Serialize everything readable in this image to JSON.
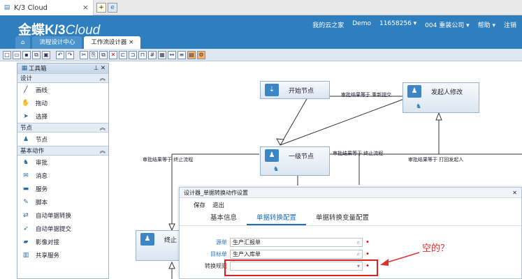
{
  "browser": {
    "tab_title": "K/3 Cloud",
    "close": "×"
  },
  "header": {
    "logo_main": "金蝶K/3",
    "logo_sub": "Cloud",
    "nav": [
      "我的云之家",
      "Demo",
      "11658256 ▾",
      "004 重装公司 ▾",
      "帮助 ▾",
      "注销"
    ]
  },
  "page_tabs": [
    {
      "label": "⌂"
    },
    {
      "label": "流程设计中心"
    },
    {
      "label": "工作流设计器  ×"
    }
  ],
  "toolbox": {
    "title": "工具箱",
    "pin": "⊥ ✕",
    "sections": [
      {
        "name": "设计",
        "items": [
          "画线",
          "拖动",
          "选择"
        ]
      },
      {
        "name": "节点",
        "items": [
          "节点"
        ]
      },
      {
        "name": "基本动作",
        "items": [
          "审批",
          "消息",
          "服务",
          "脚本",
          "自动单据转换",
          "自动单据提交",
          "影像对接",
          "共享服务"
        ]
      }
    ]
  },
  "canvas": {
    "nodes": {
      "start": "开始节点",
      "initiator": "发起人修改",
      "level1": "一级节点",
      "end": "终止"
    },
    "labels": {
      "resubmit": "审批结果等于 重新提交",
      "terminate1": "审批结果等于 终止流程",
      "terminate2": "审批结果等于 终止流程",
      "returnback": "审批结果等于 打回发起人"
    }
  },
  "dialog": {
    "title": "设计器_单据转换动作设置",
    "close": "✕",
    "menu": [
      "保存",
      "退出"
    ],
    "tabs": [
      "基本信息",
      "单据转换配置",
      "单据转换变量配置"
    ],
    "active_tab": "单据转换配置",
    "fields": {
      "source_label": "源单",
      "source_value": "生产汇报单",
      "target_label": "目标单",
      "target_value": "生产入库单",
      "rule_label": "转换规则",
      "rule_value": ""
    }
  },
  "annotation": "空的？",
  "colors": {
    "header": "#2f7fbf",
    "accent": "#1e6fb8",
    "annotation": "#e03030"
  }
}
